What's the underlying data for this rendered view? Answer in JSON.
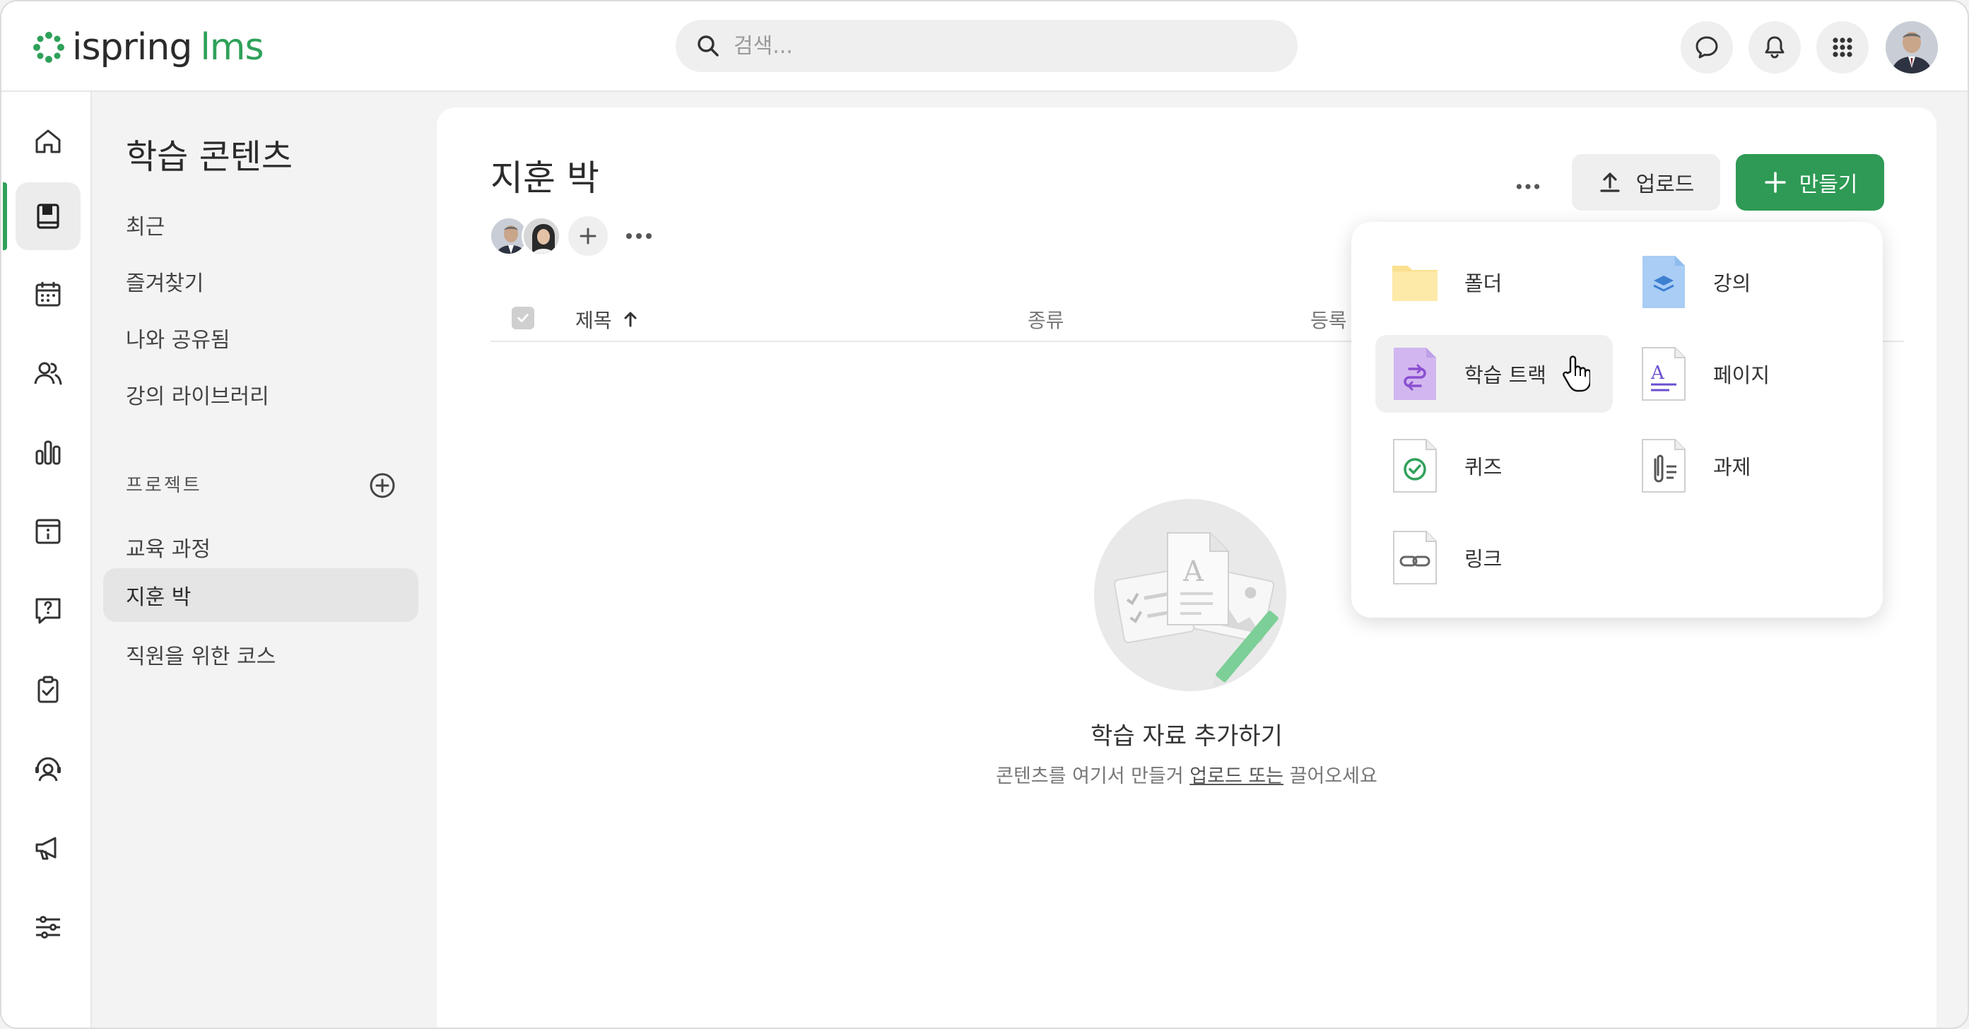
{
  "brand": {
    "logo_main": "ispring",
    "logo_accent": "lms",
    "accent_color": "#2fa15a"
  },
  "search": {
    "placeholder": "검색..."
  },
  "topbar_icons": [
    "chat-icon",
    "bell-icon",
    "apps-grid-icon",
    "user-avatar"
  ],
  "rail": {
    "items": [
      "home-icon",
      "book-icon",
      "calendar-icon",
      "users-icon",
      "chart-icon",
      "info-board-icon",
      "help-icon",
      "clipboard-check-icon",
      "support-agent-icon",
      "megaphone-icon",
      "sliders-icon"
    ],
    "active": "book-icon"
  },
  "nav": {
    "title": "학습 콘텐츠",
    "items": [
      "최근",
      "즐겨찾기",
      "나와 공유됨",
      "강의 라이브러리"
    ],
    "section_label": "프로젝트",
    "projects": [
      "교육 과정",
      "지훈 박",
      "직원을 위한 코스"
    ],
    "active_project": "지훈 박"
  },
  "main": {
    "title": "지훈 박",
    "upload_label": "업로드",
    "create_label": "만들기",
    "table": {
      "col_title": "제목",
      "col_type": "종류",
      "col_registered": "등록"
    },
    "empty": {
      "title": "학습 자료 추가하기",
      "sub_prefix": "콘텐츠를 여기서 만들거 ",
      "sub_link": "업로드 또는",
      "sub_suffix": " 끌어오세요"
    }
  },
  "create_menu": {
    "items": [
      {
        "label": "폴더",
        "icon": "folder-icon"
      },
      {
        "label": "강의",
        "icon": "course-icon"
      },
      {
        "label": "학습 트랙",
        "icon": "learning-track-icon"
      },
      {
        "label": "페이지",
        "icon": "page-icon"
      },
      {
        "label": "퀴즈",
        "icon": "quiz-icon"
      },
      {
        "label": "과제",
        "icon": "assignment-icon"
      },
      {
        "label": "링크",
        "icon": "link-icon"
      }
    ],
    "hovered": "학습 트랙"
  }
}
